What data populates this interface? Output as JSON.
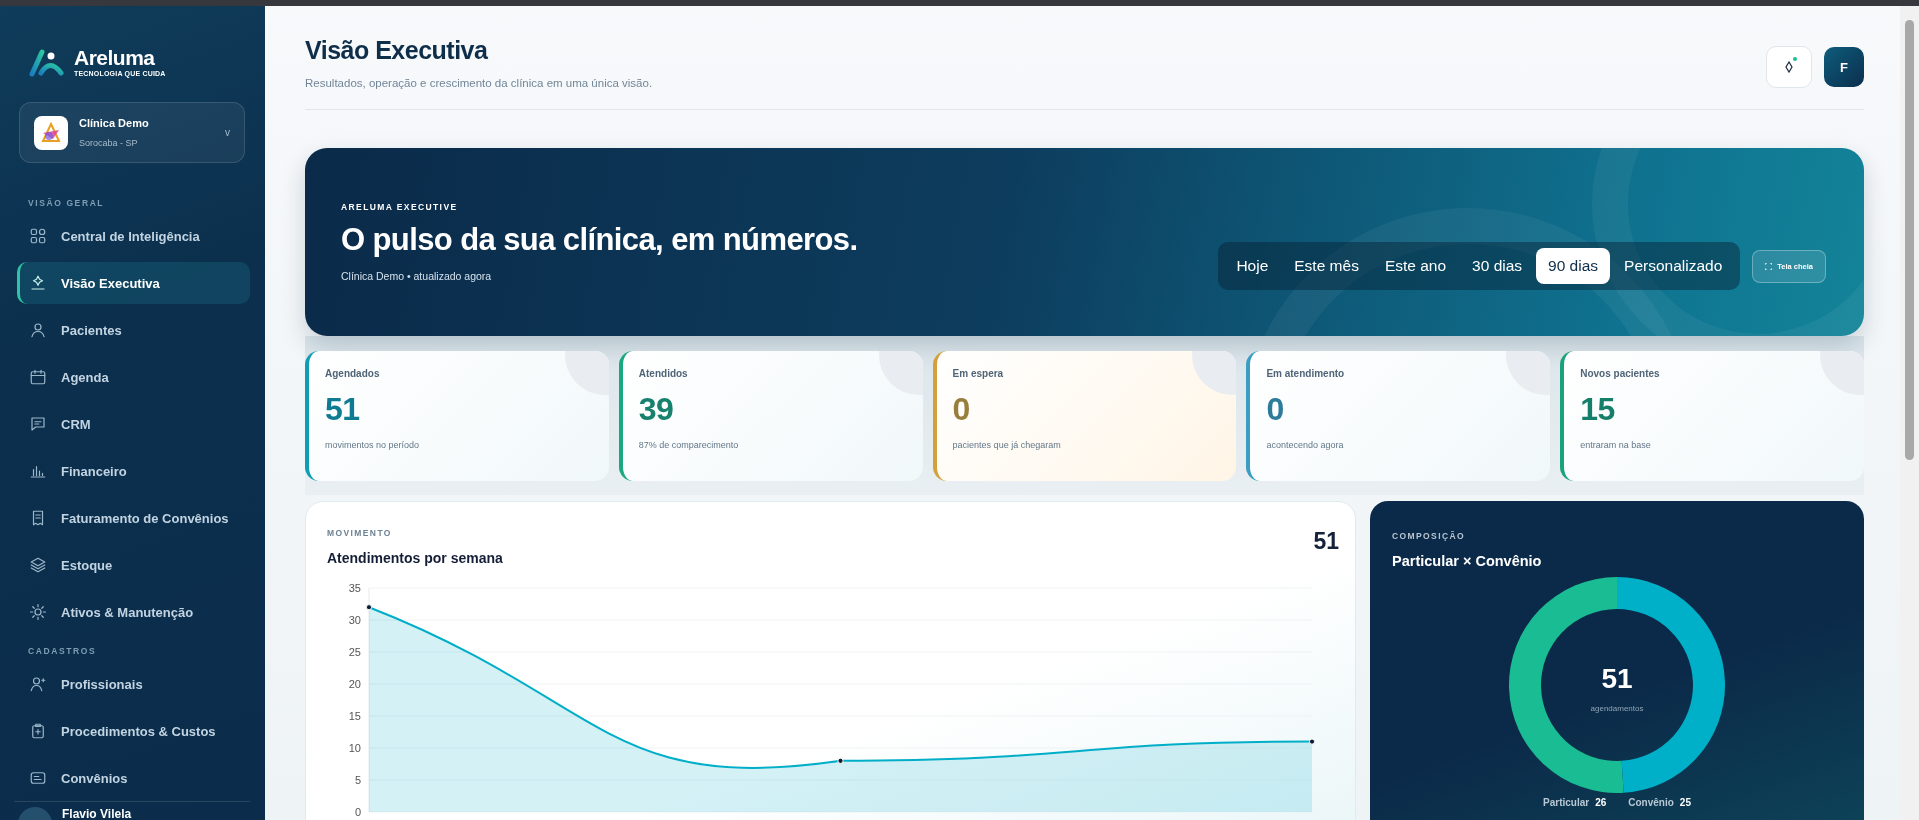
{
  "sidebar": {
    "brand": {
      "name": "Areluma",
      "tagline": "TECNOLOGIA QUE CUIDA"
    },
    "clinic": {
      "name": "Clínica Demo",
      "location": "Sorocaba - SP",
      "caret": "v"
    },
    "sections": [
      {
        "title": "VISÃO GERAL",
        "items": [
          {
            "label": "Central de Inteligência",
            "selected": false
          },
          {
            "label": "Visão Executiva",
            "selected": true
          },
          {
            "label": "Pacientes",
            "selected": false
          },
          {
            "label": "Agenda",
            "selected": false
          },
          {
            "label": "CRM",
            "selected": false
          },
          {
            "label": "Financeiro",
            "selected": false
          },
          {
            "label": "Faturamento de Convênios",
            "selected": false
          },
          {
            "label": "Estoque",
            "selected": false
          },
          {
            "label": "Ativos & Manutenção",
            "selected": false
          }
        ]
      },
      {
        "title": "CADASTROS",
        "items": [
          {
            "label": "Profissionais",
            "selected": false
          },
          {
            "label": "Procedimentos & Custos",
            "selected": false
          },
          {
            "label": "Convênios",
            "selected": false
          }
        ]
      }
    ],
    "user": {
      "name": "Flavio Vilela"
    }
  },
  "header": {
    "title": "Visão Executiva",
    "subtitle": "Resultados, operação e crescimento da clínica em uma única visão.",
    "avatar": "F"
  },
  "hero": {
    "eyebrow": "ARELUMA EXECUTIVE",
    "title": "O pulso da sua clínica, em números.",
    "subtitle": "Clínica Demo • atualizado agora",
    "periods": [
      {
        "label": "Hoje",
        "selected": false
      },
      {
        "label": "Este mês",
        "selected": false
      },
      {
        "label": "Este ano",
        "selected": false
      },
      {
        "label": "30 dias",
        "selected": false
      },
      {
        "label": "90 dias",
        "selected": true
      },
      {
        "label": "Personalizado",
        "selected": false
      }
    ],
    "fullscreen_button": "Tela cheia"
  },
  "stats": [
    {
      "label": "Agendados",
      "value": "51",
      "note": "movimentos no período",
      "color": "#0f9db5"
    },
    {
      "label": "Atendidos",
      "value": "39",
      "note": "87% de comparecimento",
      "color": "#1aa880"
    },
    {
      "label": "Em espera",
      "value": "0",
      "note": "pacientes que já chegaram",
      "color": "#d4a03c"
    },
    {
      "label": "Em atendimento",
      "value": "0",
      "note": "acontecendo agora",
      "color": "#3a9ec2"
    },
    {
      "label": "Novos pacientes",
      "value": "15",
      "note": "entraram na base",
      "color": "#1aa37a"
    }
  ],
  "movement": {
    "eyebrow": "MOVIMENTO",
    "title": "Atendimentos por semana",
    "total": "51",
    "chart_data": {
      "type": "area",
      "values": [
        32,
        8,
        11
      ],
      "ylim": [
        0,
        35
      ],
      "yticks": [
        0,
        5,
        10,
        15,
        20,
        25,
        30,
        35
      ],
      "grid": true
    }
  },
  "composition": {
    "eyebrow": "COMPOSIÇÃO",
    "title": "Particular × Convênio",
    "center_value": "51",
    "center_label": "agendamentos",
    "chart_data": {
      "type": "donut",
      "categories": [
        "Particular",
        "Convênio"
      ],
      "values": [
        26,
        25
      ],
      "colors": [
        "#1abc94",
        "#00b0c8"
      ],
      "data_labels": true
    }
  }
}
